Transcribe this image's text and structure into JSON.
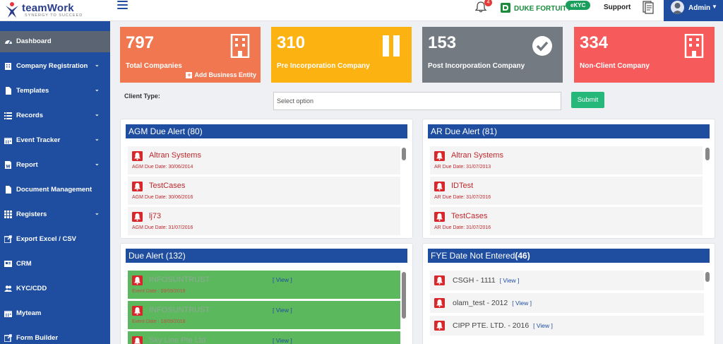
{
  "header": {
    "logo_text": "teamWork",
    "logo_tagline": "SYNERGY TO SUCCEED",
    "notification_count": "4",
    "duke_label": "DUKE FORTUITY",
    "ekyc_label": "eKYC",
    "support_label": "Support",
    "admin_label": "Admin"
  },
  "sidebar": {
    "items": [
      {
        "label": "Dashboard",
        "icon": "dashboard-icon",
        "chevron": false,
        "active": true
      },
      {
        "label": "Company Registration",
        "icon": "building-icon",
        "chevron": true
      },
      {
        "label": "Templates",
        "icon": "file-icon",
        "chevron": true
      },
      {
        "label": "Records",
        "icon": "list-icon",
        "chevron": true
      },
      {
        "label": "Event Tracker",
        "icon": "calendar-icon",
        "chevron": true
      },
      {
        "label": "Report",
        "icon": "report-icon",
        "chevron": true
      },
      {
        "label": "Document Management",
        "icon": "file-icon",
        "chevron": false
      },
      {
        "label": "Registers",
        "icon": "grid-icon",
        "chevron": true
      },
      {
        "label": "Export Excel / CSV",
        "icon": "export-icon",
        "chevron": false
      },
      {
        "label": "CRM",
        "icon": "crm-icon",
        "chevron": false
      },
      {
        "label": "KYC/CDD",
        "icon": "users-icon",
        "chevron": false
      },
      {
        "label": "Myteam",
        "icon": "calendar-icon",
        "chevron": false
      },
      {
        "label": "Form Builder",
        "icon": "export-icon",
        "chevron": false
      }
    ]
  },
  "kpis": [
    {
      "value": "797",
      "label": "Total Companies",
      "sub": "Add Business Entity",
      "color": "#f0774f",
      "icon": "building-icon"
    },
    {
      "value": "310",
      "label": "Pre Incorporation Company",
      "sub": "",
      "color": "#fcb211",
      "icon": "pause-icon"
    },
    {
      "value": "153",
      "label": "Post Incorporation Company",
      "sub": "",
      "color": "#737a82",
      "icon": "check-circle-icon"
    },
    {
      "value": "334",
      "label": "Non-Client Company",
      "sub": "",
      "color": "#f65a5b",
      "icon": "building-icon"
    }
  ],
  "filter": {
    "client_type_label": "Client Type:",
    "select_placeholder": "Select option",
    "submit_label": "Submit"
  },
  "agm": {
    "title": "AGM Due Alert (80)",
    "items": [
      {
        "name": "Altran Systems",
        "date": "AGM Due Date: 30/06/2014"
      },
      {
        "name": "TestCases",
        "date": "AGM Due Date: 30/06/2016"
      },
      {
        "name": "lj73",
        "date": "AGM Due Date: 31/07/2016"
      }
    ]
  },
  "ar": {
    "title": "AR Due Alert (81)",
    "items": [
      {
        "name": "Altran Systems",
        "date": "AR Due Date: 31/07/2013"
      },
      {
        "name": "IDTest",
        "date": "AR Due Date: 31/07/2016"
      },
      {
        "name": "TestCases",
        "date": "AR Due Date: 31/07/2016"
      }
    ]
  },
  "due": {
    "title": "Due Alert (132)",
    "view_label": "[ View ]",
    "items": [
      {
        "name": "INFOSUNTRUST",
        "date": "Event Date : 09/09/2018"
      },
      {
        "name": "INFOSUNTRUST",
        "date": "Event Date : 18/09/2018"
      },
      {
        "name": "Sky Line Pte Ltd",
        "date": ""
      }
    ]
  },
  "fye": {
    "title_text": "FYE Date Not Entered",
    "title_count": "(46)",
    "view_label": "[ View ]",
    "items": [
      {
        "name": "CSGH - 1111"
      },
      {
        "name": "olam_test - 2012"
      },
      {
        "name": "CIPP PTE. LTD. - 2016"
      }
    ]
  },
  "colors": {
    "primary": "#1f4ea1",
    "alert_red": "#c0282d",
    "due_green": "#5cb85c",
    "submit_green": "#26b87a"
  }
}
